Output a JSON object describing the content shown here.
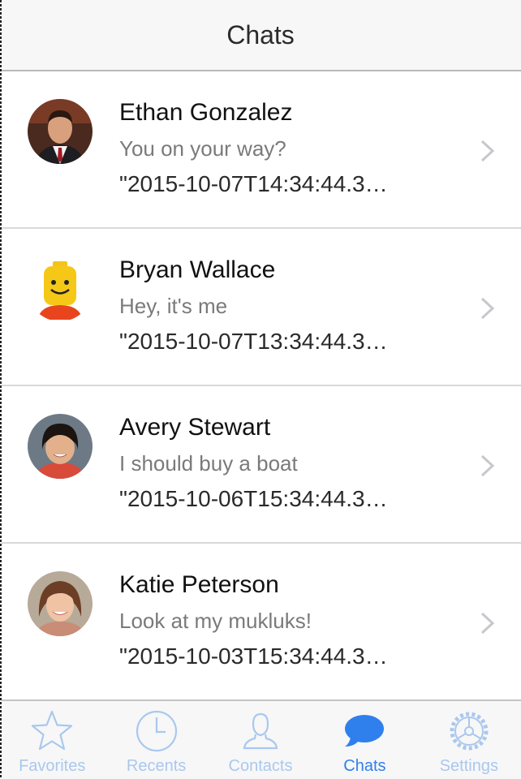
{
  "header": {
    "title": "Chats"
  },
  "chats": [
    {
      "name": "Ethan Gonzalez",
      "message": "You on your way?",
      "timestamp": "\"2015-10-07T14:34:44.3…",
      "avatar_icon": "man-portrait-avatar"
    },
    {
      "name": "Bryan Wallace",
      "message": "Hey, it's me",
      "timestamp": "\"2015-10-07T13:34:44.3…",
      "avatar_icon": "lego-head-avatar"
    },
    {
      "name": "Avery Stewart",
      "message": "I should buy a boat",
      "timestamp": "\"2015-10-06T15:34:44.3…",
      "avatar_icon": "woman-portrait-avatar"
    },
    {
      "name": "Katie Peterson",
      "message": "Look at my mukluks!",
      "timestamp": "\"2015-10-03T15:34:44.3…",
      "avatar_icon": "woman-portrait-avatar"
    }
  ],
  "tabbar": {
    "tabs": [
      {
        "label": "Favorites",
        "icon": "star-icon",
        "active": false
      },
      {
        "label": "Recents",
        "icon": "clock-icon",
        "active": false
      },
      {
        "label": "Contacts",
        "icon": "person-icon",
        "active": false
      },
      {
        "label": "Chats",
        "icon": "chat-bubble-icon",
        "active": true
      },
      {
        "label": "Settings",
        "icon": "gear-icon",
        "active": false
      }
    ]
  },
  "colors": {
    "accent": "#2f80ed",
    "inactive_tab": "#a9c8ef",
    "separator": "#d9d9dd",
    "secondary_text": "#7a7a7a"
  }
}
